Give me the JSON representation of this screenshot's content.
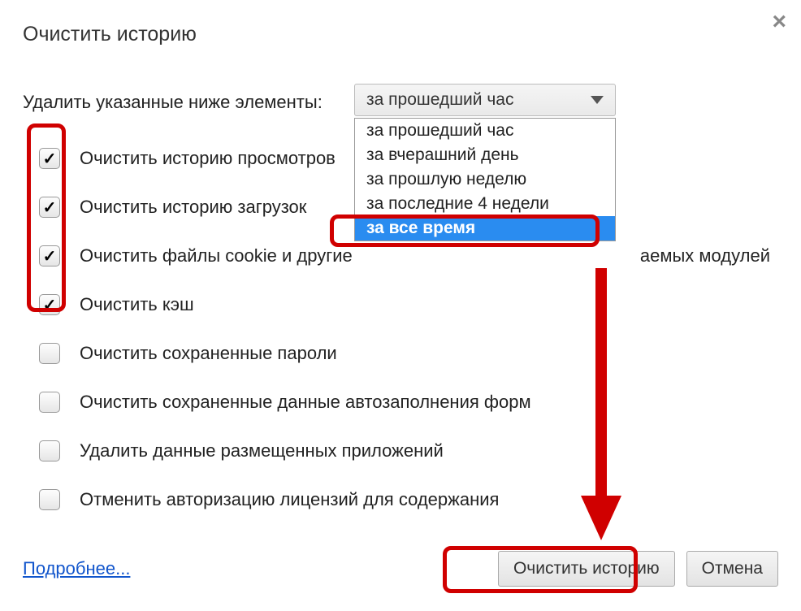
{
  "title": "Очистить историю",
  "prompt": "Удалить указанные ниже элементы:",
  "select": {
    "selected": "за прошедший час",
    "options": [
      "за прошедший час",
      "за вчерашний день",
      "за прошлую неделю",
      "за последние 4 недели",
      "за все время"
    ],
    "highlight_index": 4
  },
  "checks": [
    {
      "label": "Очистить историю просмотров",
      "checked": true,
      "trailing": ""
    },
    {
      "label": "Очистить историю загрузок",
      "checked": true,
      "trailing": ""
    },
    {
      "label": "Очистить файлы cookie и другие",
      "checked": true,
      "trailing": "аемых модулей"
    },
    {
      "label": "Очистить кэш",
      "checked": true,
      "trailing": ""
    },
    {
      "label": "Очистить сохраненные пароли",
      "checked": false,
      "trailing": ""
    },
    {
      "label": "Очистить сохраненные данные автозаполнения форм",
      "checked": false,
      "trailing": ""
    },
    {
      "label": "Удалить данные размещенных приложений",
      "checked": false,
      "trailing": ""
    },
    {
      "label": "Отменить авторизацию лицензий для содержания",
      "checked": false,
      "trailing": ""
    }
  ],
  "more_link": "Подробнее...",
  "buttons": {
    "clear": "Очистить историю",
    "cancel": "Отмена"
  }
}
